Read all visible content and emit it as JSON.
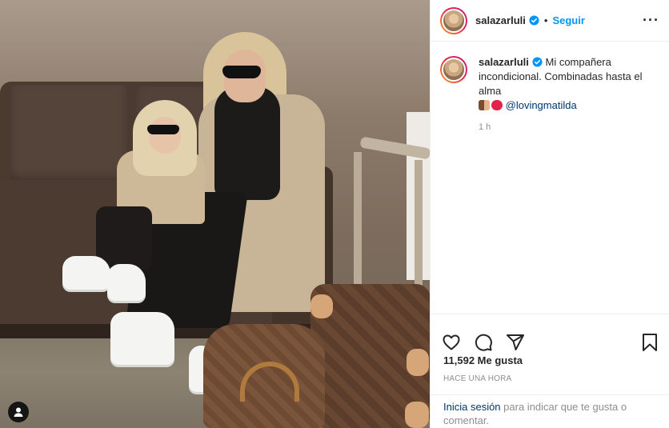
{
  "post": {
    "username": "salazarluli",
    "follow_label": "Seguir",
    "separator": "•",
    "more_label": "···",
    "caption_text": "Mi compañera incondicional. Combinadas hasta el alma",
    "caption_mention": "@lovingmatilda",
    "caption_emojis": [
      "people-holding-hands",
      "kiss-mark"
    ],
    "caption_time": "1 h",
    "likes": "11,592 Me gusta",
    "posted_when": "HACE UNA HORA"
  },
  "footer": {
    "login_link": "Inicia sesión",
    "login_rest": "para indicar que te gusta o comentar."
  },
  "icons": [
    "verified-icon",
    "heart-icon",
    "comment-icon",
    "share-icon",
    "bookmark-icon",
    "user-icon"
  ],
  "colors": {
    "accent": "#0095f6",
    "verified": "#0095f6",
    "link": "#00376b",
    "muted": "#8e8e8e"
  }
}
